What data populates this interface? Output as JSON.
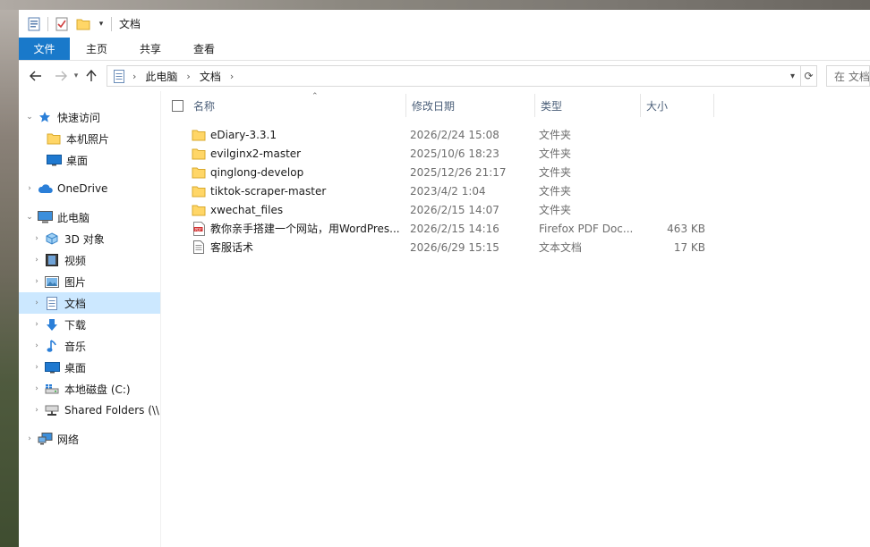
{
  "window": {
    "title": "文档"
  },
  "ribbon": {
    "tabs": [
      "文件",
      "主页",
      "共享",
      "查看"
    ]
  },
  "address": {
    "segments": [
      "此电脑",
      "文档"
    ],
    "search_placeholder": "在 文档"
  },
  "nav": {
    "items": [
      {
        "label": "快速访问",
        "icon": "star-icon",
        "level": 0,
        "expanded": true
      },
      {
        "label": "本机照片",
        "icon": "folder-icon",
        "level": 1
      },
      {
        "label": "桌面",
        "icon": "desktop-icon",
        "level": 1
      },
      {
        "label": "OneDrive",
        "icon": "cloud-icon",
        "level": 0
      },
      {
        "label": "此电脑",
        "icon": "computer-icon",
        "level": 0,
        "expanded": true
      },
      {
        "label": "3D 对象",
        "icon": "3d-objects-icon",
        "level": 1
      },
      {
        "label": "视频",
        "icon": "video-icon",
        "level": 1
      },
      {
        "label": "图片",
        "icon": "pictures-icon",
        "level": 1
      },
      {
        "label": "文档",
        "icon": "documents-icon",
        "level": 1,
        "selected": true
      },
      {
        "label": "下载",
        "icon": "download-icon",
        "level": 1
      },
      {
        "label": "音乐",
        "icon": "music-icon",
        "level": 1
      },
      {
        "label": "桌面",
        "icon": "desktop-icon",
        "level": 1
      },
      {
        "label": "本地磁盘 (C:)",
        "icon": "drive-icon",
        "level": 1
      },
      {
        "label": "Shared Folders (\\\\",
        "icon": "network-drive-icon",
        "level": 1
      },
      {
        "label": "网络",
        "icon": "network-icon",
        "level": 0
      }
    ]
  },
  "columns": {
    "name": "名称",
    "date": "修改日期",
    "type": "类型",
    "size": "大小"
  },
  "files": [
    {
      "name": "eDiary-3.3.1",
      "date": "2026/2/24 15:08",
      "type": "文件夹",
      "size": "",
      "icon": "folder-icon"
    },
    {
      "name": "evilginx2-master",
      "date": "2025/10/6 18:23",
      "type": "文件夹",
      "size": "",
      "icon": "folder-icon"
    },
    {
      "name": "qinglong-develop",
      "date": "2025/12/26 21:17",
      "type": "文件夹",
      "size": "",
      "icon": "folder-icon"
    },
    {
      "name": "tiktok-scraper-master",
      "date": "2023/4/2 1:04",
      "type": "文件夹",
      "size": "",
      "icon": "folder-icon"
    },
    {
      "name": "xwechat_files",
      "date": "2026/2/15 14:07",
      "type": "文件夹",
      "size": "",
      "icon": "folder-icon"
    },
    {
      "name": "教你亲手搭建一个网站，用WordPres...",
      "date": "2026/2/15 14:16",
      "type": "Firefox PDF Doc...",
      "size": "463 KB",
      "icon": "pdf-icon"
    },
    {
      "name": "客服话术",
      "date": "2026/6/29 15:15",
      "type": "文本文档",
      "size": "17 KB",
      "icon": "text-file-icon"
    }
  ]
}
